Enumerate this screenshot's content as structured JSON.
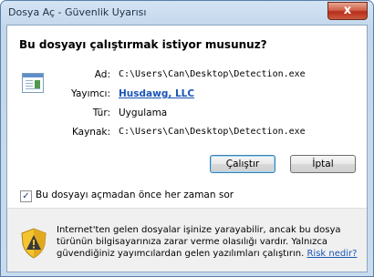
{
  "window": {
    "title": "Dosya Aç - Güvenlik Uyarısı",
    "close_label": "x"
  },
  "question": "Bu dosyayı çalıştırmak istiyor musunuz?",
  "file_icon": "exe-file-icon",
  "details": [
    {
      "label": "Ad:",
      "value": "C:\\Users\\Can\\Desktop\\Detection.exe"
    },
    {
      "label": "Yayımcı:",
      "value": "Husdawg, LLC"
    },
    {
      "label": "Tür:",
      "value": "Uygulama"
    },
    {
      "label": "Kaynak:",
      "value": "C:\\Users\\Can\\Desktop\\Detection.exe"
    }
  ],
  "buttons": {
    "run": "Çalıştır",
    "cancel": "İptal"
  },
  "checkbox": {
    "checked": true,
    "label": "Bu dosyayı açmadan önce her zaman sor"
  },
  "warning": {
    "icon": "shield-warning-icon",
    "text": "Internet'ten gelen dosyalar işinize yarayabilir, ancak bu dosya türünün bilgisayarınıza zarar verme olasılığı vardır. Yalnızca güvendiğiniz yayımcılardan gelen yazılımları çalıştırın.",
    "link": "Risk nedir?"
  },
  "colors": {
    "link": "#1a55b7",
    "close_button": "#c7442d",
    "shield_yellow": "#f4c430"
  }
}
